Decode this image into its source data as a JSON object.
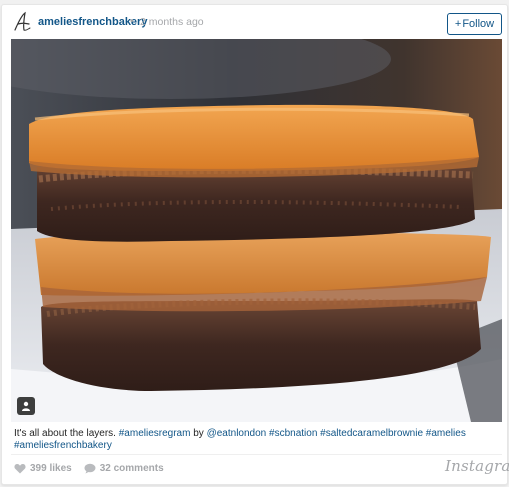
{
  "post": {
    "username": "ameliesfrenchbakery",
    "separator": "•",
    "time": "2 months ago",
    "follow": {
      "plus": "+",
      "label": "Follow"
    }
  },
  "caption": {
    "text_1": "It's all about the layers.",
    "tag_1": "#ameliesregram",
    "by": "by",
    "mention": "@eatnlondon",
    "tag_2": "#scbnation",
    "tag_3": "#saltedcaramelbrownie",
    "tag_4": "#amelies",
    "tag_5": "#ameliesfrenchbakery"
  },
  "stats": {
    "likes": "399 likes",
    "comments": "32 comments"
  },
  "brand": "Instagram",
  "colors": {
    "link": "#125688",
    "muted": "#a5a7aa",
    "caramel": "#e3892f",
    "brownie": "#4a3027"
  },
  "icons": [
    "avatar-logo-icon",
    "user-tag-icon",
    "heart-icon",
    "comment-icon"
  ]
}
